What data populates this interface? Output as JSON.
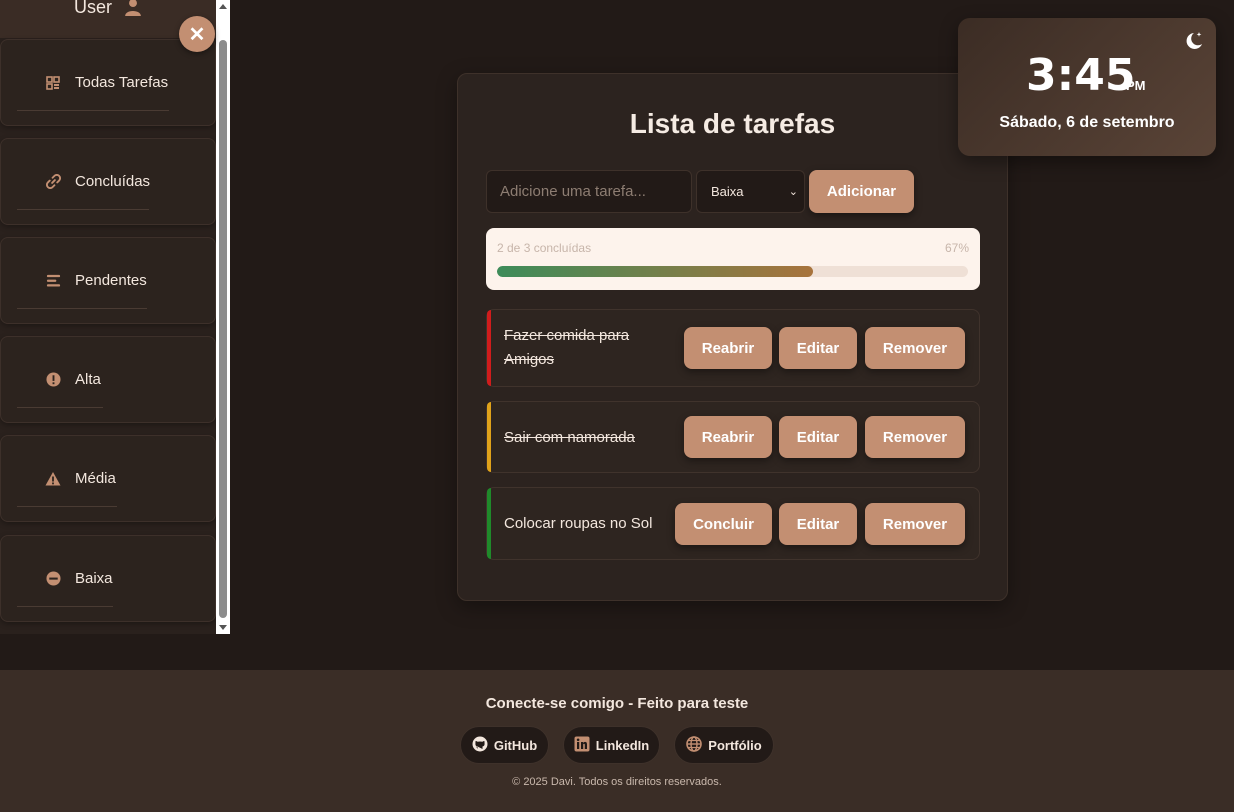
{
  "sidebar": {
    "user_label": "User",
    "close_label": "✕",
    "items": [
      {
        "label": "Todas Tarefas",
        "icon": "grid-icon"
      },
      {
        "label": "Concluídas",
        "icon": "link-icon"
      },
      {
        "label": "Pendentes",
        "icon": "bars-icon"
      },
      {
        "label": "Alta",
        "icon": "exclamation-circle-icon"
      },
      {
        "label": "Média",
        "icon": "warning-triangle-icon"
      },
      {
        "label": "Baixa",
        "icon": "minus-circle-icon"
      }
    ]
  },
  "main": {
    "title": "Lista de tarefas",
    "input_placeholder": "Adicione uma tarefa...",
    "input_value": "",
    "priority_selected": "Baixa",
    "add_label": "Adicionar",
    "progress": {
      "text": "2 de 3 concluídas",
      "percent_label": "67%",
      "fraction": 0.67
    },
    "tasks": [
      {
        "text": "Fazer comida para Amigos",
        "done": true,
        "priority_color": "#d01c1c",
        "primary_action": "Reabrir",
        "edit": "Editar",
        "remove": "Remover"
      },
      {
        "text": "Sair com namorada",
        "done": true,
        "priority_color": "#e0a21a",
        "primary_action": "Reabrir",
        "edit": "Editar",
        "remove": "Remover"
      },
      {
        "text": "Colocar roupas no Sol",
        "done": false,
        "priority_color": "#1f8a2a",
        "primary_action": "Concluir",
        "edit": "Editar",
        "remove": "Remover"
      }
    ]
  },
  "clock": {
    "time": "3:45",
    "ampm": "PM",
    "date": "Sábado, 6 de setembro",
    "theme_icon": "moon-stars-icon"
  },
  "footer": {
    "title": "Conecte-se comigo - Feito para teste",
    "links": [
      {
        "label": "GitHub",
        "icon": "github-icon"
      },
      {
        "label": "LinkedIn",
        "icon": "linkedin-icon"
      },
      {
        "label": "Portfólio",
        "icon": "globe-icon"
      }
    ],
    "copyright": "© 2025 Davi. Todos os direitos reservados."
  },
  "colors": {
    "accent": "#c38f72",
    "background": "#221a17",
    "card": "#2c231f"
  }
}
